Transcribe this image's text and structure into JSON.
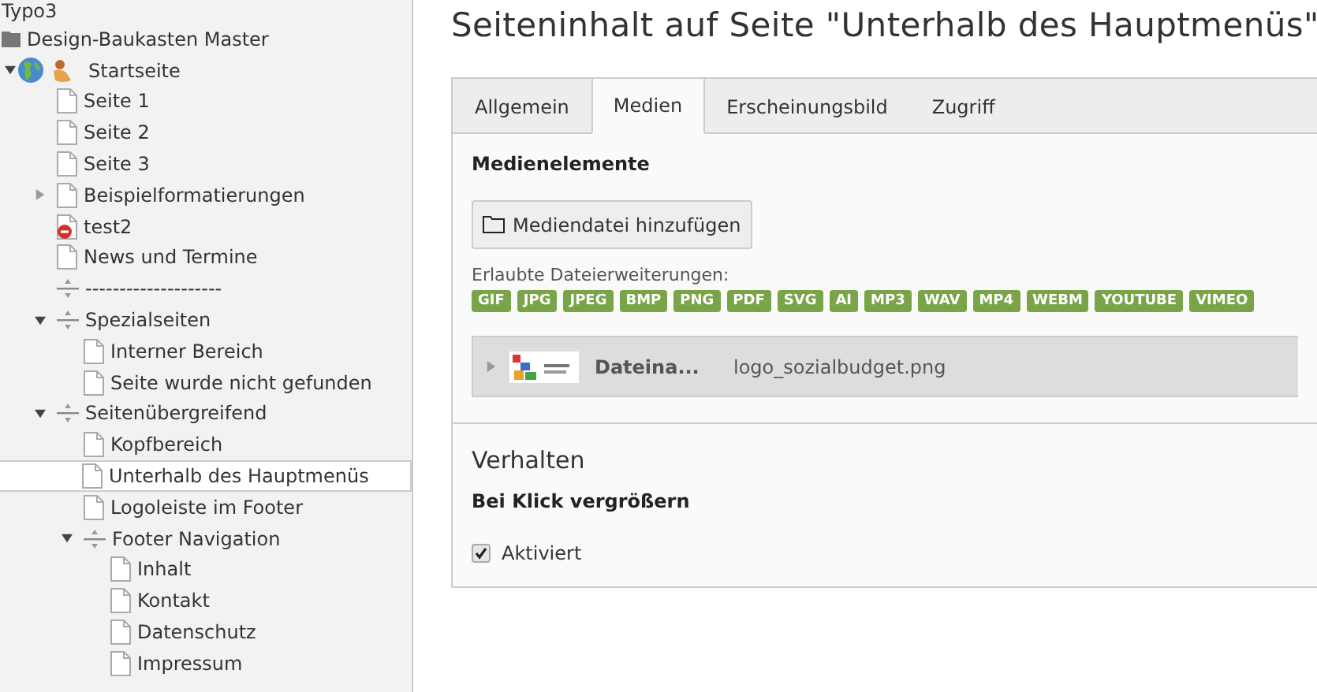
{
  "tree": {
    "title": "Typo3",
    "items": [
      {
        "label": "Design-Baukasten Master",
        "kind": "mount",
        "selected": false,
        "children": [
          {
            "label": "Startseite",
            "kind": "site",
            "expanded": true,
            "selected": false,
            "children": [
              {
                "label": "Seite 1",
                "kind": "page",
                "selected": false
              },
              {
                "label": "Seite 2",
                "kind": "page",
                "selected": false
              },
              {
                "label": "Seite 3",
                "kind": "page",
                "selected": false
              },
              {
                "label": "Beispielformatierungen",
                "kind": "page",
                "expanded": false,
                "selected": false
              },
              {
                "label": "test2",
                "kind": "hidden-page",
                "selected": false
              },
              {
                "label": "News und Termine",
                "kind": "page",
                "selected": false
              },
              {
                "label": "--------------------",
                "kind": "spacer",
                "selected": false
              },
              {
                "label": "Spezialseiten",
                "kind": "spacer",
                "expanded": true,
                "selected": false,
                "children": [
                  {
                    "label": "Interner Bereich",
                    "kind": "page",
                    "selected": false
                  },
                  {
                    "label": "Seite wurde nicht gefunden",
                    "kind": "page",
                    "selected": false
                  }
                ]
              },
              {
                "label": "Seitenübergreifend",
                "kind": "spacer",
                "expanded": true,
                "selected": false,
                "children": [
                  {
                    "label": "Kopfbereich",
                    "kind": "page",
                    "selected": false
                  },
                  {
                    "label": "Unterhalb des Hauptmenüs",
                    "kind": "page",
                    "selected": true
                  },
                  {
                    "label": "Logoleiste im Footer",
                    "kind": "page",
                    "selected": false
                  },
                  {
                    "label": "Footer Navigation",
                    "kind": "spacer",
                    "expanded": true,
                    "selected": false,
                    "children": [
                      {
                        "label": "Inhalt",
                        "kind": "page",
                        "selected": false
                      },
                      {
                        "label": "Kontakt",
                        "kind": "page",
                        "selected": false
                      },
                      {
                        "label": "Datenschutz",
                        "kind": "page",
                        "selected": false
                      },
                      {
                        "label": "Impressum",
                        "kind": "page",
                        "selected": false
                      }
                    ]
                  }
                ]
              }
            ]
          }
        ]
      }
    ]
  },
  "heading": "Seiteninhalt auf Seite \"Unterhalb des Hauptmenüs\"",
  "tabs": [
    {
      "label": "Allgemein",
      "selected": false
    },
    {
      "label": "Medien",
      "selected": true
    },
    {
      "label": "Erscheinungsbild",
      "selected": false
    },
    {
      "label": "Zugriff",
      "selected": false
    }
  ],
  "media": {
    "title": "Medienelemente",
    "add_button": "Mediendatei hinzufügen",
    "extensions_label": "Erlaubte Dateierweiterungen:",
    "extensions": [
      "GIF",
      "JPG",
      "JPEG",
      "BMP",
      "PNG",
      "PDF",
      "SVG",
      "AI",
      "MP3",
      "WAV",
      "MP4",
      "WEBM",
      "YOUTUBE",
      "VIMEO"
    ],
    "file": {
      "expanded": false,
      "field_label": "Dateina...",
      "filename": "logo_sozialbudget.png"
    }
  },
  "behaviour": {
    "title": "Verhalten",
    "field_label": "Bei Klick vergrößern",
    "option": {
      "label": "Aktiviert",
      "checked": true
    }
  }
}
